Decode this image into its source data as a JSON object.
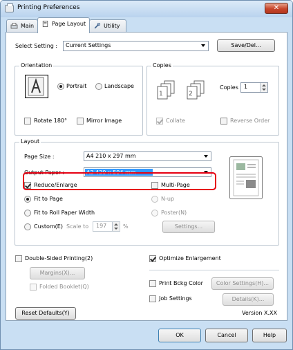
{
  "window": {
    "title": "Printing Preferences",
    "close_glyph": "✕"
  },
  "tabs": [
    {
      "label": "Main",
      "icon": "printer-icon"
    },
    {
      "label": "Page Layout",
      "icon": "page-layout-icon",
      "active": true
    },
    {
      "label": "Utility",
      "icon": "utility-icon"
    }
  ],
  "select_setting": {
    "label": "Select Setting :",
    "value": "Current Settings",
    "save_del_label": "Save/Del..."
  },
  "orientation": {
    "title": "Orientation",
    "portrait_label": "Portrait",
    "landscape_label": "Landscape",
    "selected": "Portrait",
    "rotate_label": "Rotate 180°",
    "mirror_label": "Mirror Image"
  },
  "copies": {
    "title": "Copies",
    "copies_label": "Copies :",
    "value": "1",
    "collate_label": "Collate",
    "reverse_label": "Reverse Order"
  },
  "layout": {
    "title": "Layout",
    "page_size_label": "Page Size :",
    "page_size_value": "A4 210 x 297 mm",
    "output_paper_label": "Output Paper :",
    "output_paper_value": "A2 420 x 594 mm",
    "reduce_enlarge_label": "Reduce/Enlarge",
    "fit_to_page_label": "Fit to Page",
    "fit_roll_label": "Fit to Roll Paper Width",
    "custom_label": "Custom(E)",
    "scale_label": "Scale to",
    "scale_value": "197",
    "percent": "%",
    "multi_page_label": "Multi-Page",
    "nup_label": "N-up",
    "poster_label": "Poster(N)",
    "settings_label": "Settings..."
  },
  "double_sided": {
    "label": "Double-Sided Printing(2)",
    "margins_label": "Margins(X)...",
    "folded_label": "Folded Booklet(Q)"
  },
  "optimize": {
    "label": "Optimize Enlargement"
  },
  "print_bkg": {
    "label": "Print Bckg Color",
    "color_settings_label": "Color Settings(H)..."
  },
  "job_settings": {
    "label": "Job Settings",
    "details_label": "Details(K)..."
  },
  "reset_label": "Reset Defaults(Y)",
  "version": "Version X.XX",
  "footer": {
    "ok": "OK",
    "cancel": "Cancel",
    "help": "Help"
  }
}
